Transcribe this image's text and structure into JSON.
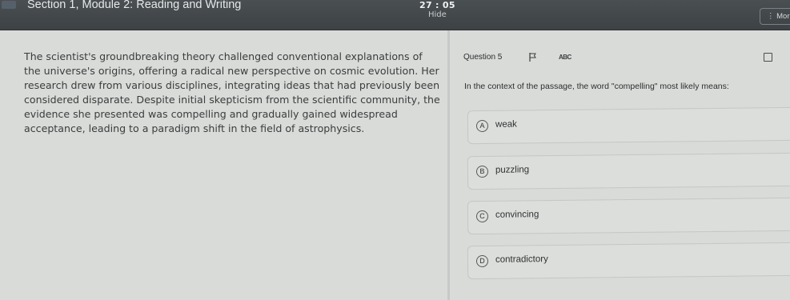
{
  "header": {
    "section_title": "Section 1, Module 2: Reading and Writing",
    "timer": "27 : 05",
    "hide_label": "Hide",
    "more_label": "⋮ More"
  },
  "passage": {
    "text": "The scientist's groundbreaking theory challenged conventional explanations of the universe's origins, offering a radical new perspective on cosmic evolution. Her research drew from various disciplines, integrating ideas that had previously been considered disparate. Despite initial skepticism from the scientific community, the evidence she presented was compelling and gradually gained widespread acceptance, leading to a paradigm shift in the field of astrophysics."
  },
  "question": {
    "number_label": "Question 5",
    "abc_label": "ABC",
    "prompt": "In the context of the passage, the word \"compelling\" most likely means:",
    "choices": [
      {
        "letter": "A",
        "text": "weak"
      },
      {
        "letter": "B",
        "text": "puzzling"
      },
      {
        "letter": "C",
        "text": "convincing"
      },
      {
        "letter": "D",
        "text": "contradictory"
      }
    ]
  },
  "icons": {
    "menu": "menu-icon",
    "flag": "flag-icon",
    "strike": "abc-strikethrough-icon",
    "annotate": "annotate-icon"
  },
  "colors": {
    "topbar": "#3d4245",
    "background": "#d9dbd9",
    "text": "#2c2f2e"
  }
}
